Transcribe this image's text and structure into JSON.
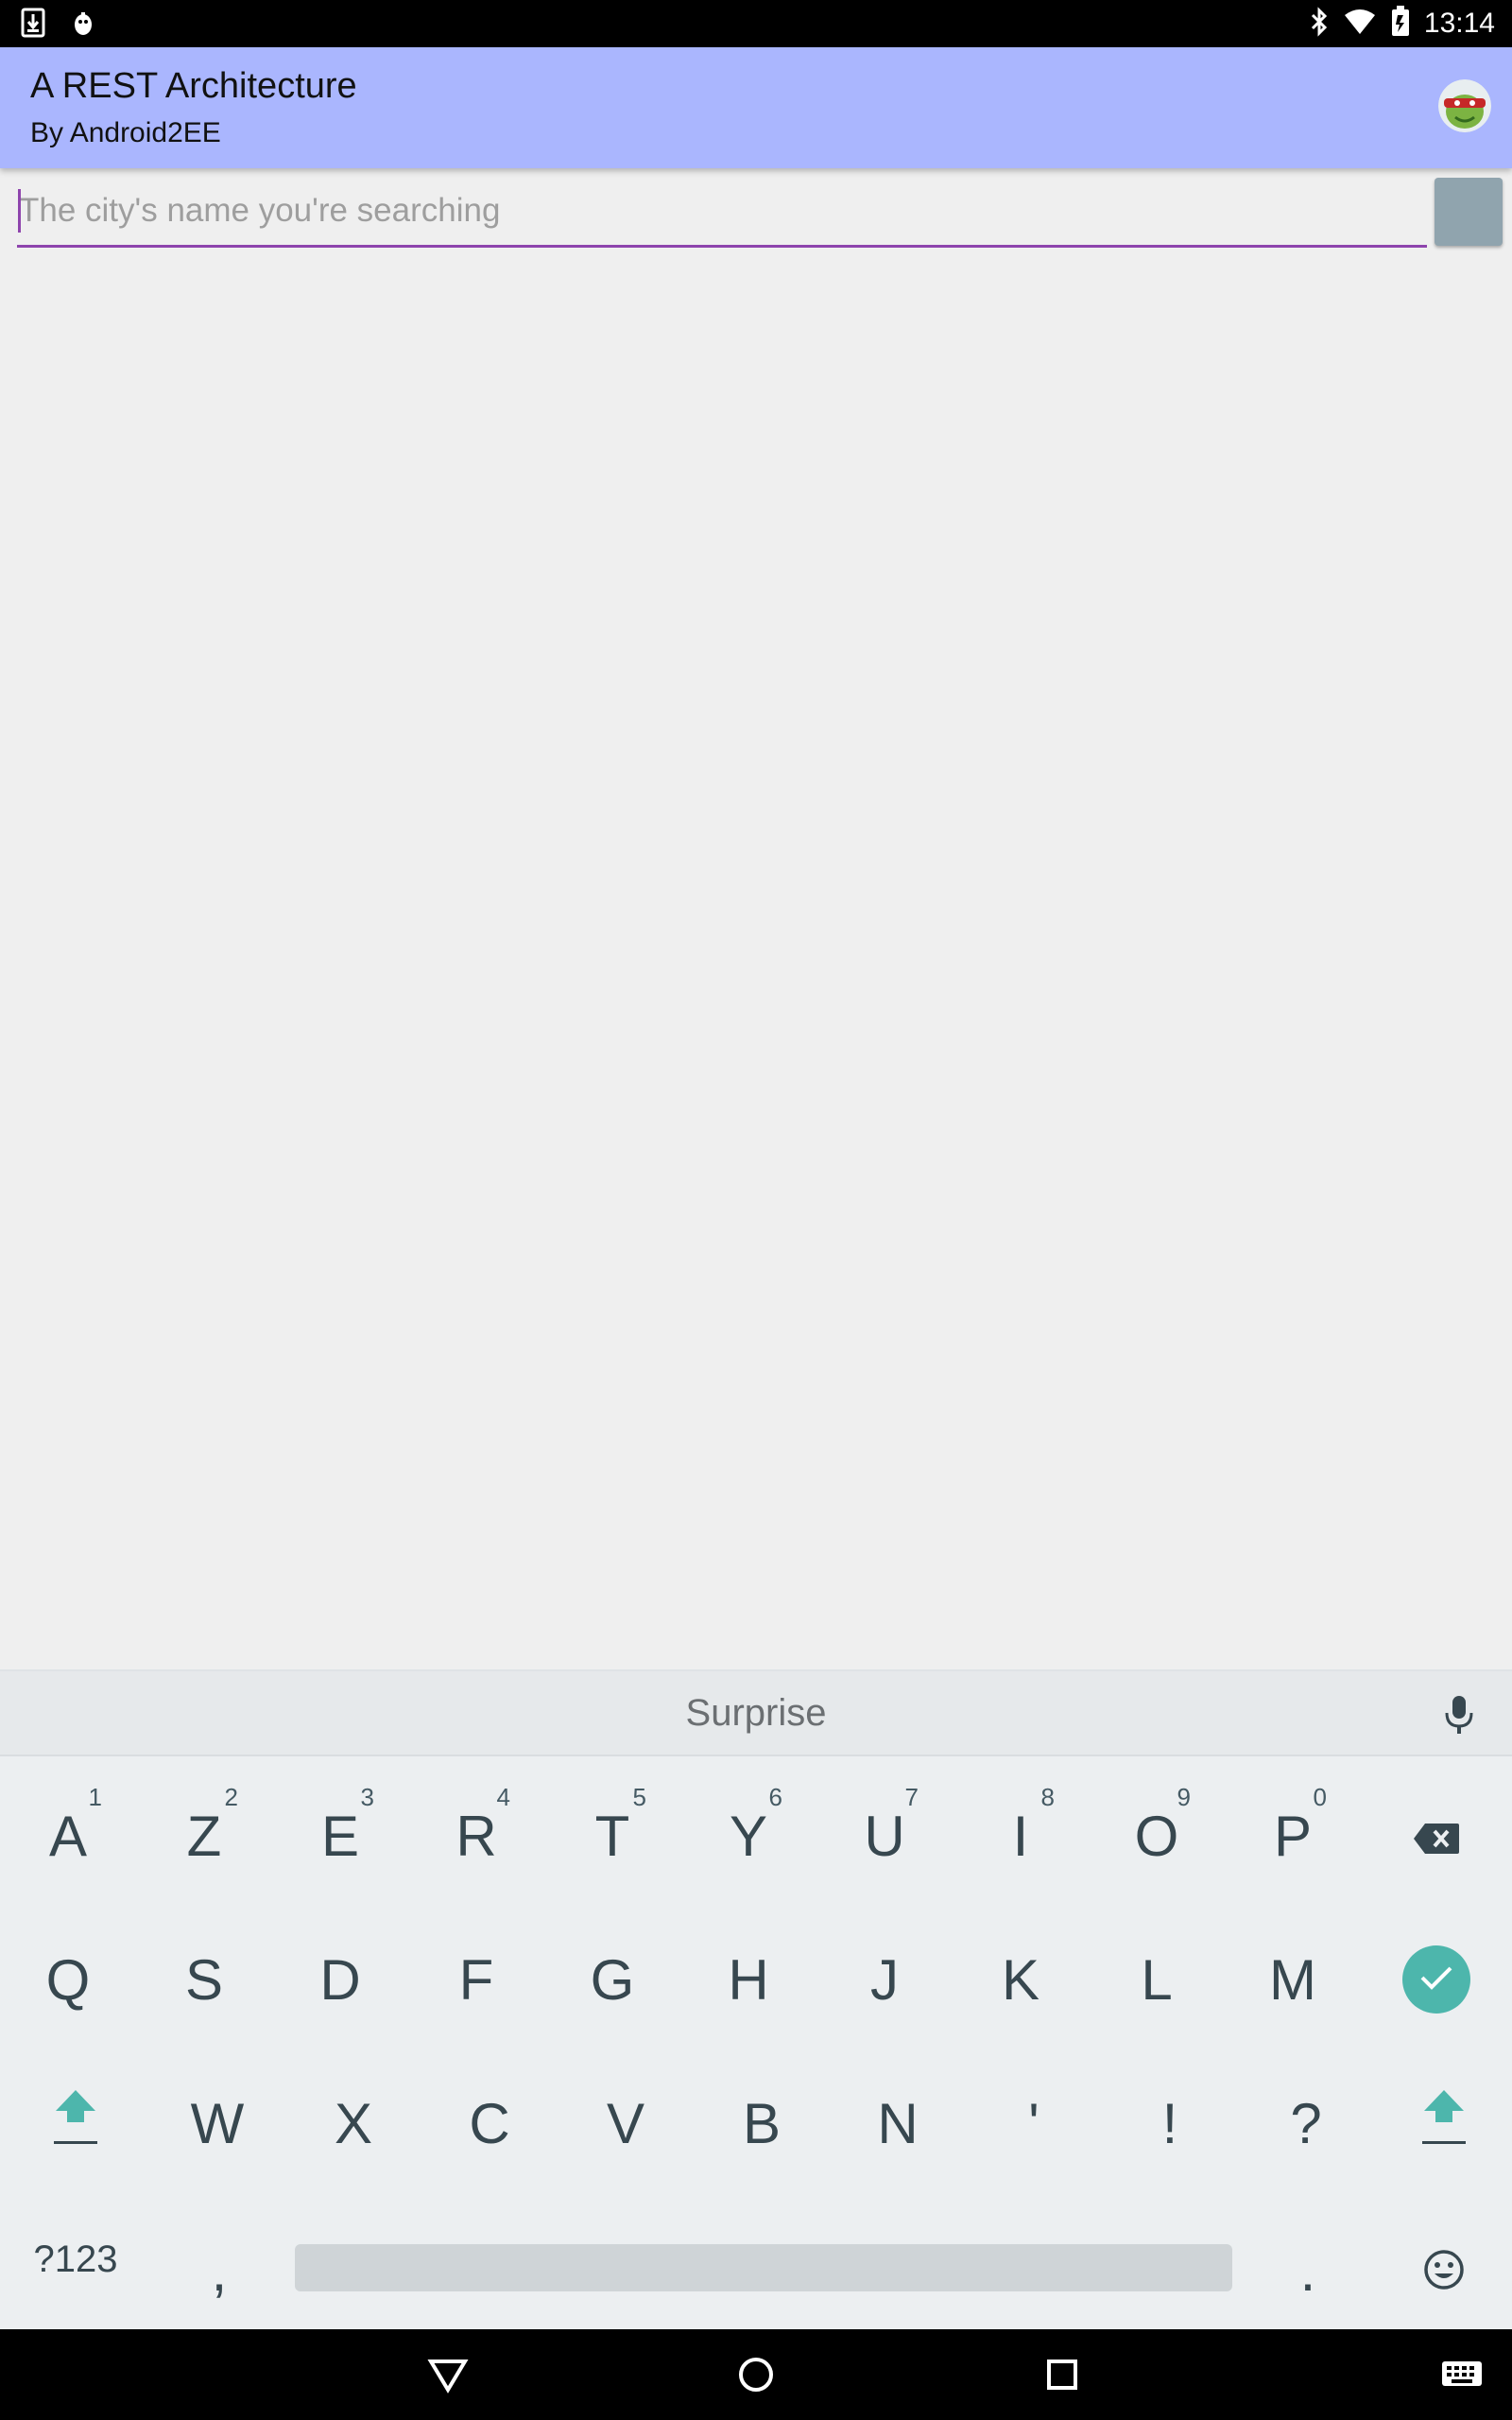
{
  "status_bar": {
    "time": "13:14",
    "left_icons": [
      "download-icon",
      "android-debug-icon"
    ],
    "right_icons": [
      "bluetooth-icon",
      "wifi-icon",
      "battery-icon"
    ]
  },
  "app_bar": {
    "title": "A REST Architecture",
    "subtitle": "By Android2EE",
    "avatar_icon": "ninja-turtle-avatar-icon"
  },
  "search": {
    "placeholder": "The city's name you're searching",
    "value": ""
  },
  "keyboard": {
    "suggestion": "Surprise",
    "row1": [
      {
        "label": "A",
        "hint": "1"
      },
      {
        "label": "Z",
        "hint": "2"
      },
      {
        "label": "E",
        "hint": "3"
      },
      {
        "label": "R",
        "hint": "4"
      },
      {
        "label": "T",
        "hint": "5"
      },
      {
        "label": "Y",
        "hint": "6"
      },
      {
        "label": "U",
        "hint": "7"
      },
      {
        "label": "I",
        "hint": "8"
      },
      {
        "label": "O",
        "hint": "9"
      },
      {
        "label": "P",
        "hint": "0"
      }
    ],
    "row2": [
      "Q",
      "S",
      "D",
      "F",
      "G",
      "H",
      "J",
      "K",
      "L",
      "M"
    ],
    "row3": [
      "W",
      "X",
      "C",
      "V",
      "B",
      "N",
      "'",
      "!",
      "?"
    ],
    "symbols_label": "?123",
    "comma_label": ",",
    "period_label": "."
  },
  "colors": {
    "app_bar": "#aab6fe",
    "accent": "#8e44ad",
    "keyboard_accent": "#4db6ac",
    "search_button": "#90a4ae"
  }
}
